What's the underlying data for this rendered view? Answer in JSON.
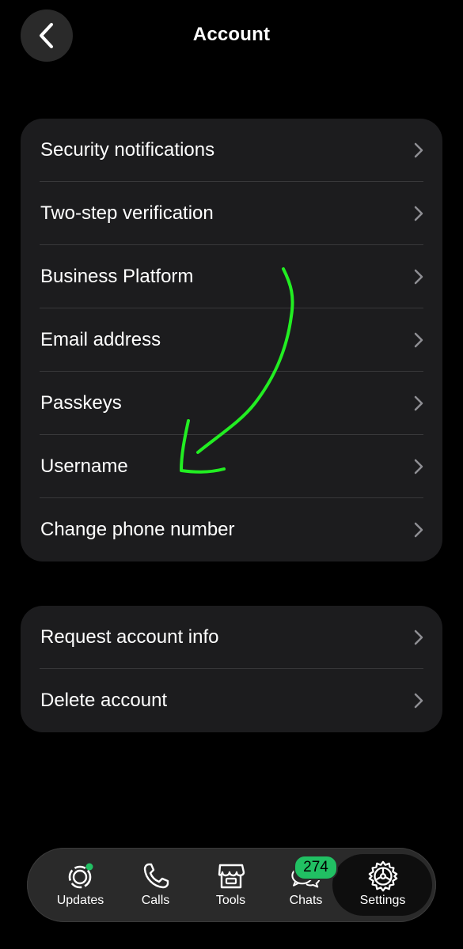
{
  "header": {
    "title": "Account",
    "back_icon": "chevron-left-icon"
  },
  "groups": [
    {
      "items": [
        {
          "label": "Security notifications"
        },
        {
          "label": "Two-step verification"
        },
        {
          "label": "Business Platform"
        },
        {
          "label": "Email address"
        },
        {
          "label": "Passkeys"
        },
        {
          "label": "Username"
        },
        {
          "label": "Change phone number"
        }
      ]
    },
    {
      "items": [
        {
          "label": "Request account info"
        },
        {
          "label": "Delete account"
        }
      ]
    }
  ],
  "tabbar": {
    "tabs": [
      {
        "label": "Updates",
        "icon": "updates-icon"
      },
      {
        "label": "Calls",
        "icon": "phone-icon"
      },
      {
        "label": "Tools",
        "icon": "storefront-icon"
      },
      {
        "label": "Chats",
        "icon": "chat-bubbles-icon",
        "badge": "274"
      },
      {
        "label": "Settings",
        "icon": "gear-icon",
        "active": true
      }
    ]
  },
  "colors": {
    "background": "#000000",
    "card": "#1c1c1e",
    "badge": "#21c063",
    "annotation_arrow": "#22ff22"
  }
}
